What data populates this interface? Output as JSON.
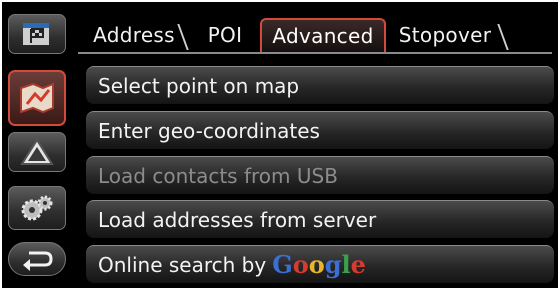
{
  "tabs": [
    {
      "label": "Address",
      "selected": false
    },
    {
      "label": "POI",
      "selected": false
    },
    {
      "label": "Advanced",
      "selected": true
    },
    {
      "label": "Stopover",
      "selected": false
    }
  ],
  "menu": [
    {
      "label": "Select point on map",
      "enabled": true
    },
    {
      "label": "Enter geo-coordinates",
      "enabled": true
    },
    {
      "label": "Load contacts from USB",
      "enabled": false
    },
    {
      "label": "Load addresses from server",
      "enabled": true
    },
    {
      "label": "Online search by",
      "enabled": true
    }
  ],
  "google_logo": {
    "letters": [
      "G",
      "o",
      "o",
      "g",
      "l",
      "e"
    ],
    "colors": [
      "#3b6fd4",
      "#d63b2f",
      "#e8b62a",
      "#3b6fd4",
      "#3aa14a",
      "#d63b2f"
    ]
  },
  "side_icons": [
    "destination-flag-icon",
    "route-map-icon",
    "warning-triangle-icon",
    "settings-gears-icon",
    "back-arrow-icon"
  ],
  "accent_color": "#d14a3a"
}
